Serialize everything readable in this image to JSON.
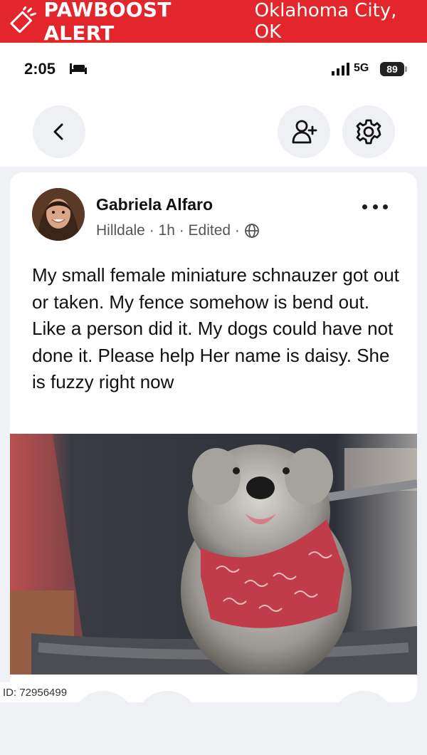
{
  "banner": {
    "brand": "PAWBOOST ALERT",
    "location": "Oklahoma City, OK",
    "icon": "megaphone-icon",
    "color": "#e3262b"
  },
  "status_bar": {
    "time": "2:05",
    "network": "5G",
    "battery": "89"
  },
  "nav": {
    "back_icon": "chevron-left-icon",
    "add_friend_icon": "add-person-icon",
    "settings_icon": "gear-icon"
  },
  "post": {
    "author": "Gabriela Alfaro",
    "meta": "Hilldale · 1h · Edited ·",
    "text": "My small female miniature schnauzer got out or taken. My fence somehow is bend out. Like a person did it. My dogs could have not done it. Please help Her name is daisy. She is fuzzy right now"
  },
  "listing_id": "ID: 72956499"
}
